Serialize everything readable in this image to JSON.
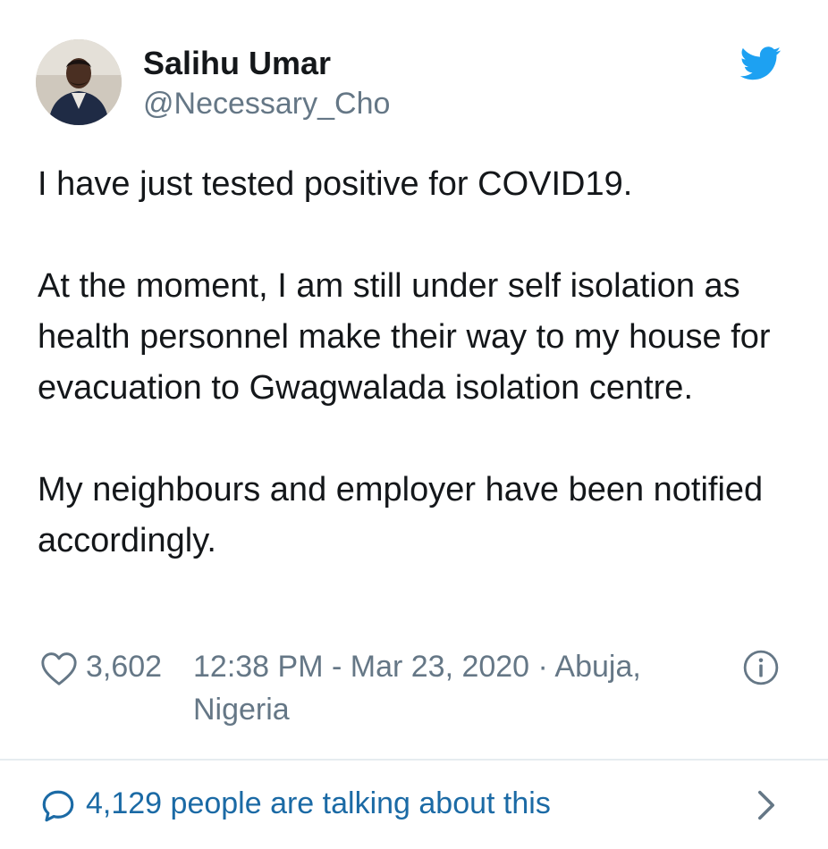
{
  "user": {
    "name": "Salihu Umar",
    "handle": "@Necessary_Cho",
    "avatar_icon": "profile-photo"
  },
  "brand": {
    "icon": "twitter-bird-icon",
    "color": "#1da1f2"
  },
  "tweet": {
    "paragraphs": [
      "I have just tested positive for COVID19.",
      "At the moment, I am still under self isolation as health personnel make their way to my house for evacuation to Gwagwalada isolation centre.",
      "My neighbours and employer have been notified accordingly."
    ]
  },
  "meta": {
    "likes": "3,602",
    "timestamp": "12:38 PM - Mar 23, 2020 · Abuja, Nigeria",
    "heart_icon": "heart-outline-icon",
    "info_icon": "info-icon"
  },
  "footer": {
    "talking": "4,129 people are talking about this",
    "reply_icon": "speech-bubble-icon",
    "chevron_icon": "chevron-right-icon",
    "link_color": "#1b6aa5"
  },
  "colors": {
    "text_primary": "#14171a",
    "text_secondary": "#657786",
    "divider": "#e6ecf0"
  }
}
